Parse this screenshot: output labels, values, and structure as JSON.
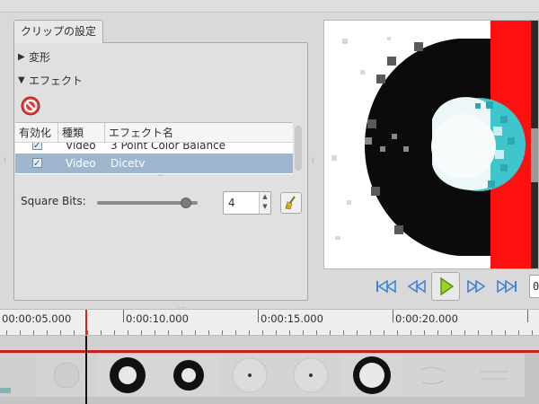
{
  "panel": {
    "tab_label": "クリップの設定",
    "expander_transform": "変形",
    "expander_effects": "エフェクト"
  },
  "effects_table": {
    "headers": [
      "有効化",
      "種類",
      "エフェクト名"
    ],
    "rows": [
      {
        "enabled": true,
        "type": "Video",
        "name": "3 Point Color Balance",
        "selected": false
      },
      {
        "enabled": true,
        "type": "Video",
        "name": "Dicetv",
        "selected": true
      }
    ]
  },
  "parameter": {
    "label": "Square Bits:",
    "value": "4",
    "slider_fraction": 0.88
  },
  "ruler": {
    "labels": [
      "00:00:05.000",
      "0:00:10.000",
      "0:00:15.000",
      "0:00:20.000"
    ]
  },
  "transport": {
    "time_display": "0"
  },
  "colors": {
    "selection": "#9eb7cf",
    "playhead": "#e02020",
    "transport_blue": "#3f82d6",
    "play_green": "#9bd12a"
  },
  "icons": {
    "remove": "remove-effect-icon",
    "reset": "broom-icon"
  }
}
